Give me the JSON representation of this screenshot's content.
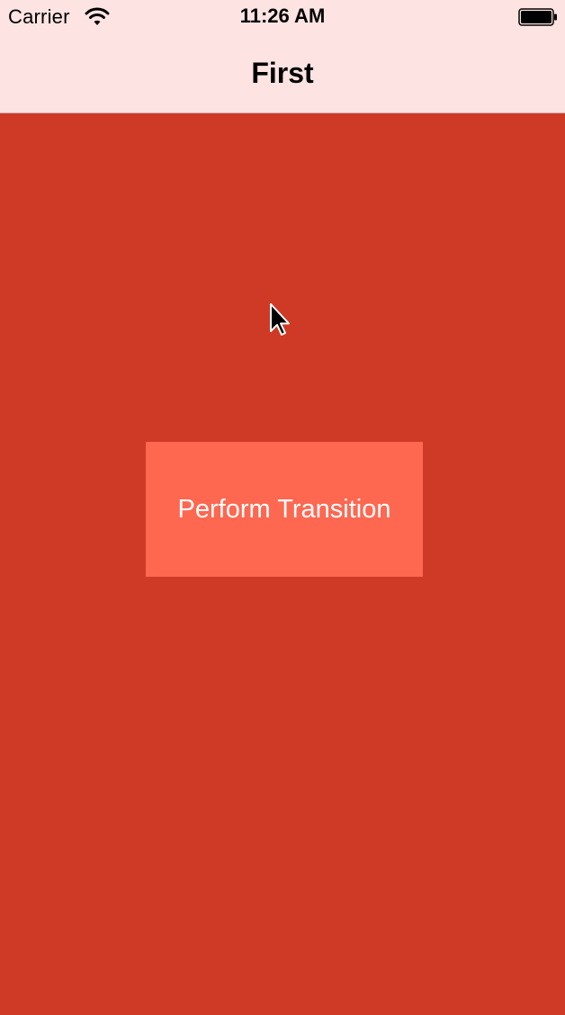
{
  "status_bar": {
    "carrier": "Carrier",
    "time": "11:26 AM",
    "wifi_icon": "wifi-icon",
    "battery_icon": "battery-icon"
  },
  "nav_bar": {
    "title": "First"
  },
  "main": {
    "button_label": "Perform Transition"
  },
  "colors": {
    "nav_background": "#fde4e2",
    "screen_background": "#cf3a26",
    "button_background": "#fe6750",
    "button_text": "#ffffff"
  },
  "cursor_icon": "mouse-pointer-icon"
}
